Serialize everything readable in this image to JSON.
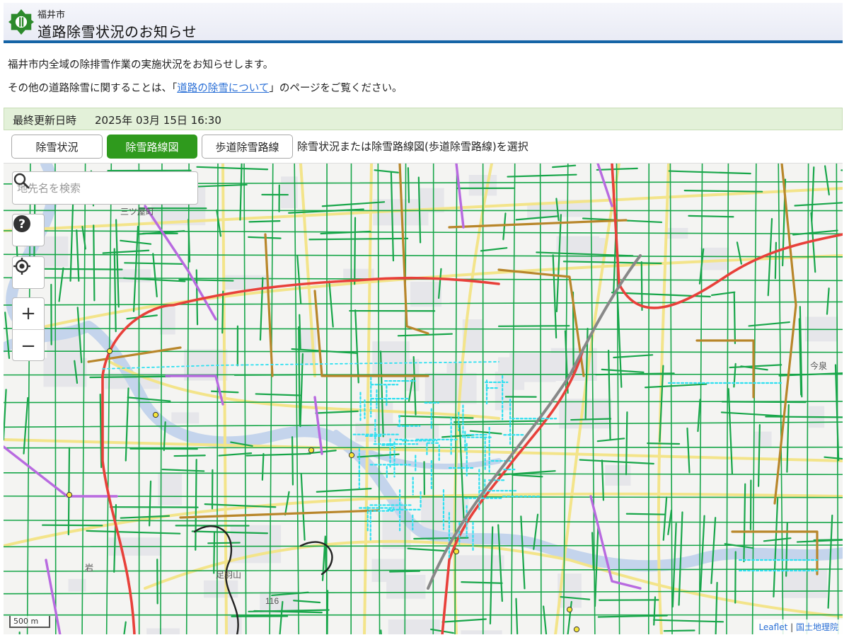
{
  "header": {
    "city": "福井市",
    "title": "道路除雪状況のお知らせ"
  },
  "intro": {
    "line1": "福井市内全域の除排雪作業の実施状況をお知らせします。",
    "line2_prefix": "その他の道路除雪に関することは、「",
    "line2_link": "道路の除雪について",
    "line2_suffix": "」のページをご覧ください。"
  },
  "status": {
    "label": "最終更新日時",
    "value": "2025年 03月 15日 16:30"
  },
  "tabs": [
    {
      "label": "除雪状況",
      "active": false
    },
    {
      "label": "除雪路線図",
      "active": true
    },
    {
      "label": "歩道除雪路線",
      "active": false
    }
  ],
  "tab_hint": "除雪状況または除雪路線図(歩道除雪路線)を選択",
  "map": {
    "search_placeholder": "地先名を検索",
    "scale_label": "500 m",
    "attribution_leaflet": "Leaflet",
    "attribution_separator": " | ",
    "attribution_gsi": "国土地理院",
    "place_labels": [
      "三ツ屋町",
      "足羽山",
      "116",
      "岩",
      "今泉"
    ],
    "route_colors": {
      "green": "#18a64a",
      "brown": "#b8862a",
      "red": "#e8403a",
      "purple": "#b86ae0",
      "yellow_road": "#f3e48a",
      "sidewalk": "#2fe0f0",
      "river": "#c4d4ec"
    },
    "icons": [
      "help-icon",
      "locate-icon",
      "zoom-in-icon",
      "zoom-out-icon",
      "search-icon"
    ]
  }
}
